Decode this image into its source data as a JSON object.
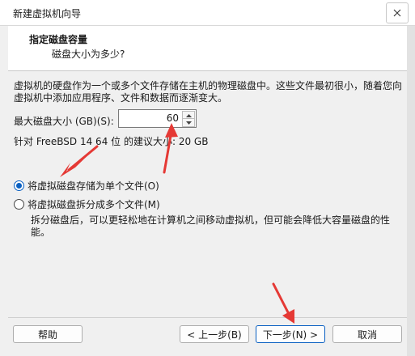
{
  "window": {
    "title": "新建虚拟机向导"
  },
  "header": {
    "title": "指定磁盘容量",
    "subtitle": "磁盘大小为多少?"
  },
  "body": {
    "description": "虚拟机的硬盘作为一个或多个文件存储在主机的物理磁盘中。这些文件最初很小，随着您向虚拟机中添加应用程序、文件和数据而逐渐变大。",
    "size_label": "最大磁盘大小 (GB)(S):",
    "size_value": "60",
    "recommended": "针对 FreeBSD 14 64 位 的建议大小: 20 GB"
  },
  "options": [
    {
      "label": "将虚拟磁盘存储为单个文件(O)",
      "checked": true
    },
    {
      "label": "将虚拟磁盘拆分成多个文件(M)",
      "checked": false
    }
  ],
  "split_note": "拆分磁盘后，可以更轻松地在计算机之间移动虚拟机，但可能会降低大容量磁盘的性能。",
  "buttons": {
    "help": "帮助",
    "back": "< 上一步(B)",
    "next": "下一步(N) >",
    "cancel": "取消"
  },
  "colors": {
    "accent": "#0a60c2",
    "annotation": "#e53935"
  }
}
